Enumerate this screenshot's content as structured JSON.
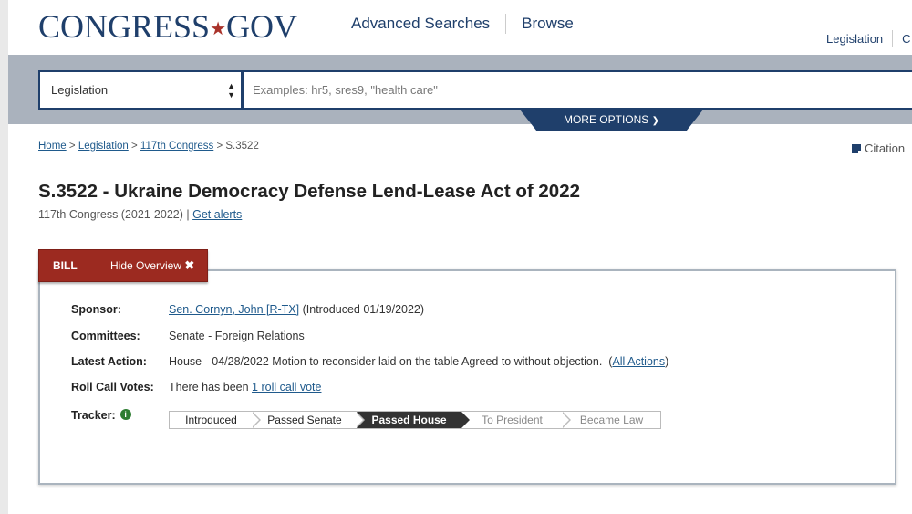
{
  "header": {
    "logo_main": "CONGRESS",
    "logo_dot": "★",
    "logo_tld": "GOV",
    "nav": [
      "Advanced Searches",
      "Browse"
    ],
    "top_links": [
      "Legislation",
      "C"
    ]
  },
  "search": {
    "collection_value": "Legislation",
    "placeholder": "Examples: hr5, sres9, \"health care\"",
    "more_options_label": "MORE OPTIONS",
    "more_options_icon": "chevron-down-icon"
  },
  "breadcrumb": {
    "items": [
      "Home",
      "Legislation",
      "117th Congress"
    ],
    "separator": ">",
    "current": "S.3522"
  },
  "citation_label": "Citation",
  "bill": {
    "title": "S.3522 - Ukraine Democracy Defense Lend-Lease Act of 2022",
    "congress": "117th Congress (2021-2022)",
    "divider": "|",
    "alerts_label": "Get alerts",
    "tab_label": "BILL",
    "hide_label": "Hide Overview",
    "hide_icon": "✖"
  },
  "overview": {
    "sponsor_label": "Sponsor:",
    "sponsor_name": "Sen. Cornyn, John [R-TX]",
    "sponsor_note": "(Introduced 01/19/2022)",
    "committees_label": "Committees:",
    "committees_value": "Senate - Foreign Relations",
    "latest_action_label": "Latest Action:",
    "latest_action_value": "House - 04/28/2022 Motion to reconsider laid on the table Agreed to without objection.",
    "all_actions_open": "(",
    "all_actions_label": "All Actions",
    "all_actions_close": ")",
    "roll_call_label": "Roll Call Votes:",
    "roll_call_prefix": "There has been",
    "roll_call_link": "1 roll call vote",
    "tracker_label": "Tracker:",
    "tracker_info_icon": "i",
    "tracker_steps": [
      "Introduced",
      "Passed Senate",
      "Passed House",
      "To President",
      "Became Law"
    ],
    "tracker_current": "Passed House"
  },
  "colors": {
    "brand_navy": "#1f3f6b",
    "brand_red": "#9c2a20",
    "band_gray": "#aab2bd",
    "link_blue": "#1f5a8c"
  }
}
